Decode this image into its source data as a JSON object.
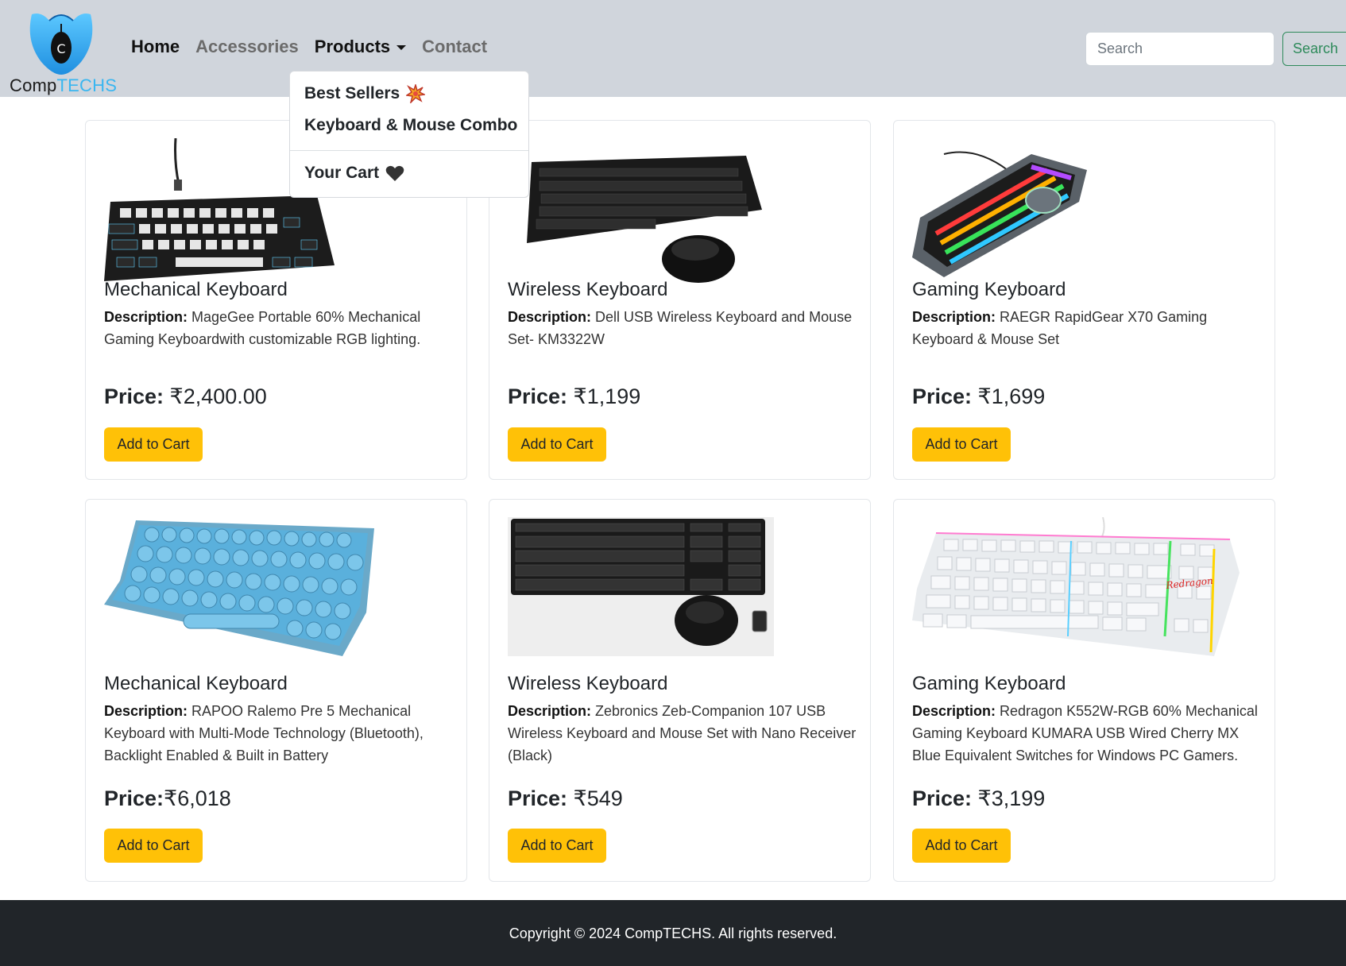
{
  "brand": {
    "name_part1": "Comp",
    "name_part2": "TECHS",
    "logo_letter": "C"
  },
  "nav": {
    "home": "Home",
    "accessories": "Accessories",
    "products": "Products",
    "contact": "Contact"
  },
  "search": {
    "placeholder": "Search",
    "button_label": "Search"
  },
  "dropdown": {
    "best_sellers": "Best Sellers",
    "combo": "Keyboard & Mouse Combo",
    "cart": "Your Cart"
  },
  "products": [
    {
      "title": "Mechanical Keyboard",
      "desc_label": "Description:",
      "desc": "MageGee Portable 60% Mechanical Gaming Keyboardwith customizable RGB lighting.",
      "price_label": "Price:",
      "price": " ₹2,400.00",
      "button": "Add to Cart"
    },
    {
      "title": "Wireless Keyboard",
      "desc_label": "Description:",
      "desc": "Dell USB Wireless Keyboard and Mouse Set- KM3322W",
      "price_label": "Price:",
      "price": " ₹1,199",
      "button": "Add to Cart"
    },
    {
      "title": "Gaming Keyboard",
      "desc_label": "Description:",
      "desc": "RAEGR RapidGear X70 Gaming Keyboard & Mouse Set",
      "price_label": "Price:",
      "price": " ₹1,699",
      "button": "Add to Cart"
    },
    {
      "title": "Mechanical Keyboard",
      "desc_label": "Description:",
      "desc": "RAPOO Ralemo Pre 5 Mechanical Keyboard with Multi-Mode Technology (Bluetooth), Backlight Enabled & Built in Battery",
      "price_label": "Price:",
      "price": "₹6,018",
      "button": "Add to Cart"
    },
    {
      "title": "Wireless Keyboard",
      "desc_label": "Description:",
      "desc": "Zebronics Zeb-Companion 107 USB Wireless Keyboard and Mouse Set with Nano Receiver (Black)",
      "price_label": "Price:",
      "price": " ₹549",
      "button": "Add to Cart"
    },
    {
      "title": "Gaming Keyboard",
      "desc_label": "Description:",
      "desc": "Redragon K552W-RGB 60% Mechanical Gaming Keyboard KUMARA USB Wired Cherry MX Blue Equivalent Switches for Windows PC Gamers.",
      "price_label": "Price:",
      "price": " ₹3,199",
      "button": "Add to Cart"
    }
  ],
  "footer": {
    "copyright": "Copyright © 2024 CompTECHS. All rights reserved."
  },
  "colors": {
    "navbar": "#d0d5dc",
    "accent_button": "#ffc107",
    "search_button": "#2d8a5a",
    "footer": "#212529",
    "brand_blue": "#39b6f0"
  }
}
